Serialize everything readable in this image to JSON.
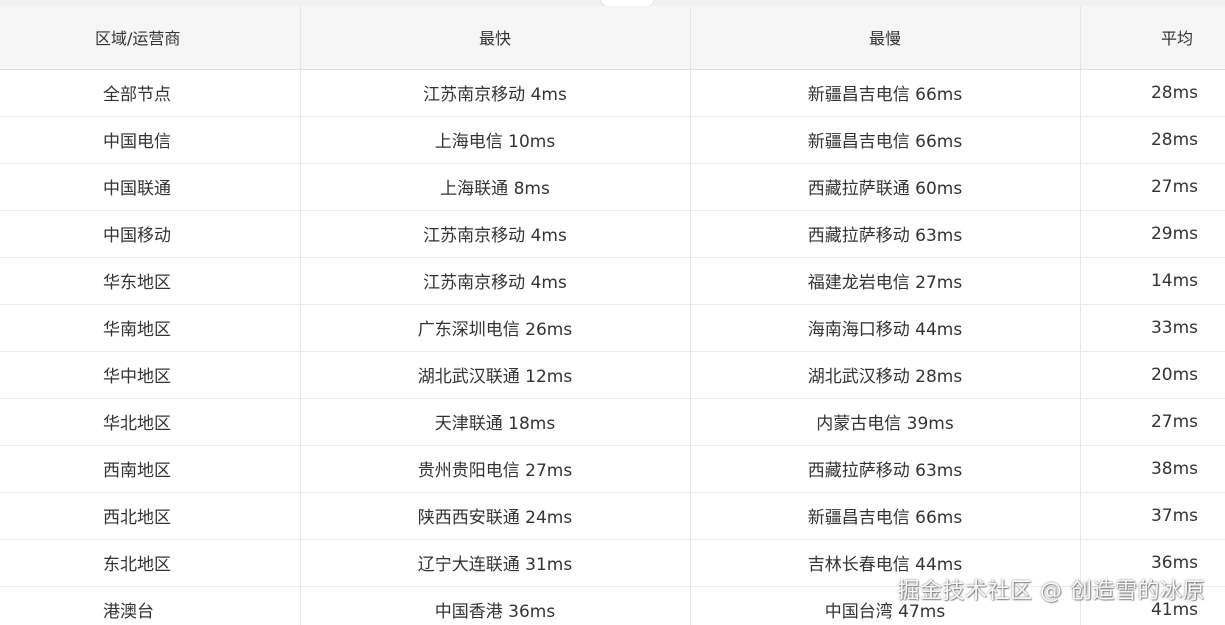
{
  "table": {
    "headers": {
      "region": "区域/运营商",
      "fastest": "最快",
      "slowest": "最慢",
      "average": "平均"
    },
    "rows": [
      {
        "region": "全部节点",
        "fastest": "江苏南京移动 4ms",
        "slowest": "新疆昌吉电信 66ms",
        "average": "28ms"
      },
      {
        "region": "中国电信",
        "fastest": "上海电信 10ms",
        "slowest": "新疆昌吉电信 66ms",
        "average": "28ms"
      },
      {
        "region": "中国联通",
        "fastest": "上海联通 8ms",
        "slowest": "西藏拉萨联通 60ms",
        "average": "27ms"
      },
      {
        "region": "中国移动",
        "fastest": "江苏南京移动 4ms",
        "slowest": "西藏拉萨移动 63ms",
        "average": "29ms"
      },
      {
        "region": "华东地区",
        "fastest": "江苏南京移动 4ms",
        "slowest": "福建龙岩电信 27ms",
        "average": "14ms"
      },
      {
        "region": "华南地区",
        "fastest": "广东深圳电信 26ms",
        "slowest": "海南海口移动 44ms",
        "average": "33ms"
      },
      {
        "region": "华中地区",
        "fastest": "湖北武汉联通 12ms",
        "slowest": "湖北武汉移动 28ms",
        "average": "20ms"
      },
      {
        "region": "华北地区",
        "fastest": "天津联通 18ms",
        "slowest": "内蒙古电信 39ms",
        "average": "27ms"
      },
      {
        "region": "西南地区",
        "fastest": "贵州贵阳电信 27ms",
        "slowest": "西藏拉萨移动 63ms",
        "average": "38ms"
      },
      {
        "region": "西北地区",
        "fastest": "陕西西安联通 24ms",
        "slowest": "新疆昌吉电信 66ms",
        "average": "37ms"
      },
      {
        "region": "东北地区",
        "fastest": "辽宁大连联通 31ms",
        "slowest": "吉林长春电信 44ms",
        "average": "36ms"
      },
      {
        "region": "港澳台",
        "fastest": "中国香港 36ms",
        "slowest": "中国台湾 47ms",
        "average": "41ms"
      }
    ]
  },
  "watermark": "掘金技术社区 @ 创造雪的冰原"
}
